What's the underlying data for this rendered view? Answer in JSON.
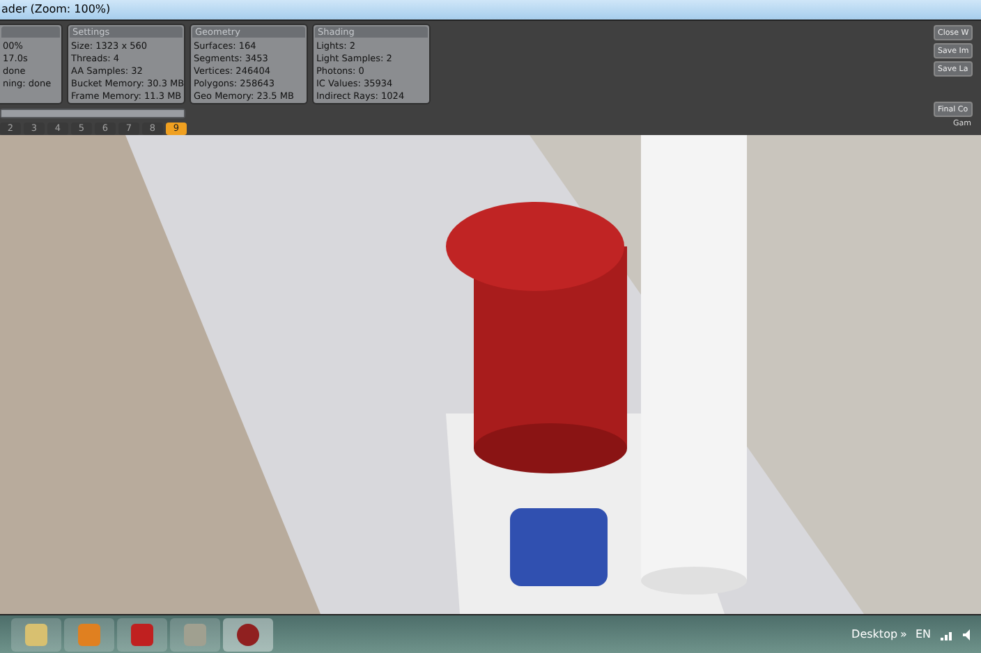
{
  "window": {
    "title": "ader (Zoom: 100%)"
  },
  "panels": [
    {
      "lines": [
        "00%",
        "17.0s",
        "done",
        "ning: done"
      ]
    },
    {
      "title": "Settings",
      "lines": [
        "Size: 1323 x 560",
        "Threads: 4",
        "AA Samples: 32",
        "Bucket Memory: 30.3 MB",
        "Frame Memory: 11.3 MB"
      ]
    },
    {
      "title": "Geometry",
      "lines": [
        "Surfaces: 164",
        "Segments: 3453",
        "Vertices: 246404",
        "Polygons: 258643",
        "Geo Memory: 23.5 MB"
      ]
    },
    {
      "title": "Shading",
      "lines": [
        "Lights: 2",
        "Light Samples: 2",
        "Photons: 0",
        "IC Values: 35934",
        "Indirect Rays: 1024"
      ]
    }
  ],
  "progress": {
    "level": 1
  },
  "passes": [
    {
      "label": "2",
      "selected": false
    },
    {
      "label": "3",
      "selected": false
    },
    {
      "label": "4",
      "selected": false
    },
    {
      "label": "5",
      "selected": false
    },
    {
      "label": "6",
      "selected": false
    },
    {
      "label": "7",
      "selected": false
    },
    {
      "label": "8",
      "selected": false
    },
    {
      "label": "9",
      "selected": true
    }
  ],
  "side_buttons": [
    "Close W",
    "Save Im",
    "Save La"
  ],
  "final_button": "Final Co",
  "side_label": "Gam",
  "taskbar": {
    "desktop": "Desktop",
    "chevron": "»",
    "language": "EN"
  }
}
